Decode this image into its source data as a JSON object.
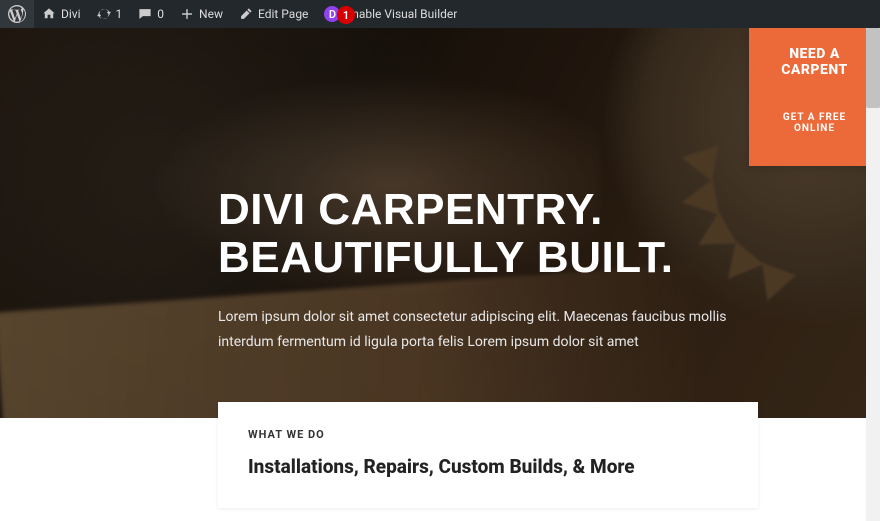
{
  "adminbar": {
    "site_name": "Divi",
    "updates_count": "1",
    "comments_count": "0",
    "new_label": "New",
    "edit_page_label": "Edit Page",
    "visual_builder_label": "Enable Visual Builder",
    "divi_letter": "D"
  },
  "annotation": {
    "number": "1"
  },
  "cta": {
    "title": "NEED A CARPENT",
    "button": "GET A FREE ONLINE"
  },
  "hero": {
    "title_line1": "DIVI CARPENTRY.",
    "title_line2": "BEAUTIFULLY BUILT.",
    "subtitle": "Lorem ipsum dolor sit amet consectetur adipiscing elit. Maecenas faucibus mollis interdum fermentum id ligula porta felis Lorem ipsum dolor sit amet"
  },
  "what": {
    "label": "WHAT WE DO",
    "heading": "Installations, Repairs, Custom Builds, & More"
  }
}
